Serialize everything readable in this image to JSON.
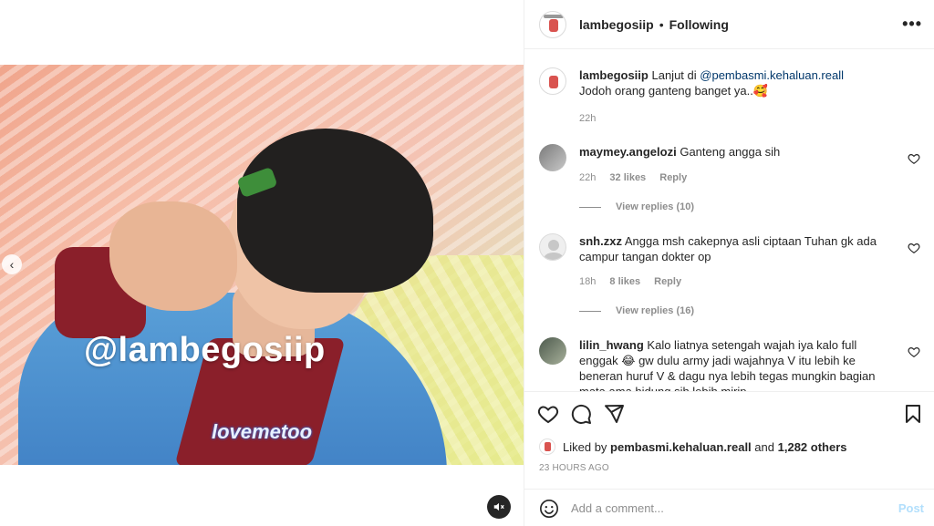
{
  "header": {
    "username": "lambegosiip",
    "separator": "•",
    "follow_status": "Following",
    "more_icon": "more-horizontal-icon"
  },
  "media": {
    "watermark": "@lambegosiip",
    "sub_watermark": "lovemetoo",
    "prev_icon": "chevron-left-icon",
    "mute_icon": "muted-speaker-icon"
  },
  "caption": {
    "username": "lambegosiip",
    "text_before": "Lanjut di",
    "mention": "@pembasmi.kehaluan.reall",
    "text_line2": "Jodoh orang ganteng banget ya..",
    "emoji": "🥰",
    "time": "22h"
  },
  "comments": [
    {
      "username": "maymey.angelozi",
      "text": "Ganteng angga sih",
      "time": "22h",
      "likes": "32 likes",
      "reply": "Reply",
      "view_replies": "View replies (10)"
    },
    {
      "username": "snh.zxz",
      "text": "Angga msh cakepnya asli ciptaan Tuhan gk ada campur tangan dokter op",
      "time": "18h",
      "likes": "8 likes",
      "reply": "Reply",
      "view_replies": "View replies (16)"
    },
    {
      "username": "lilin_hwang",
      "text": "Kalo liatnya setengah wajah iya kalo full enggak 😂 gw dulu army jadi wajahnya V itu lebih ke beneran huruf V & dagu nya lebih tegas mungkin bagian mata ama hidung sih lebih mirip"
    }
  ],
  "actions": {
    "like_icon": "heart-icon",
    "comment_icon": "comment-icon",
    "share_icon": "send-icon",
    "save_icon": "bookmark-icon"
  },
  "likes": {
    "prefix": "Liked by",
    "user": "pembasmi.kehaluan.reall",
    "and": "and",
    "others": "1,282 others"
  },
  "posted": "23 HOURS AGO",
  "add_comment": {
    "placeholder": "Add a comment...",
    "post_label": "Post",
    "emoji_icon": "smiley-icon"
  }
}
